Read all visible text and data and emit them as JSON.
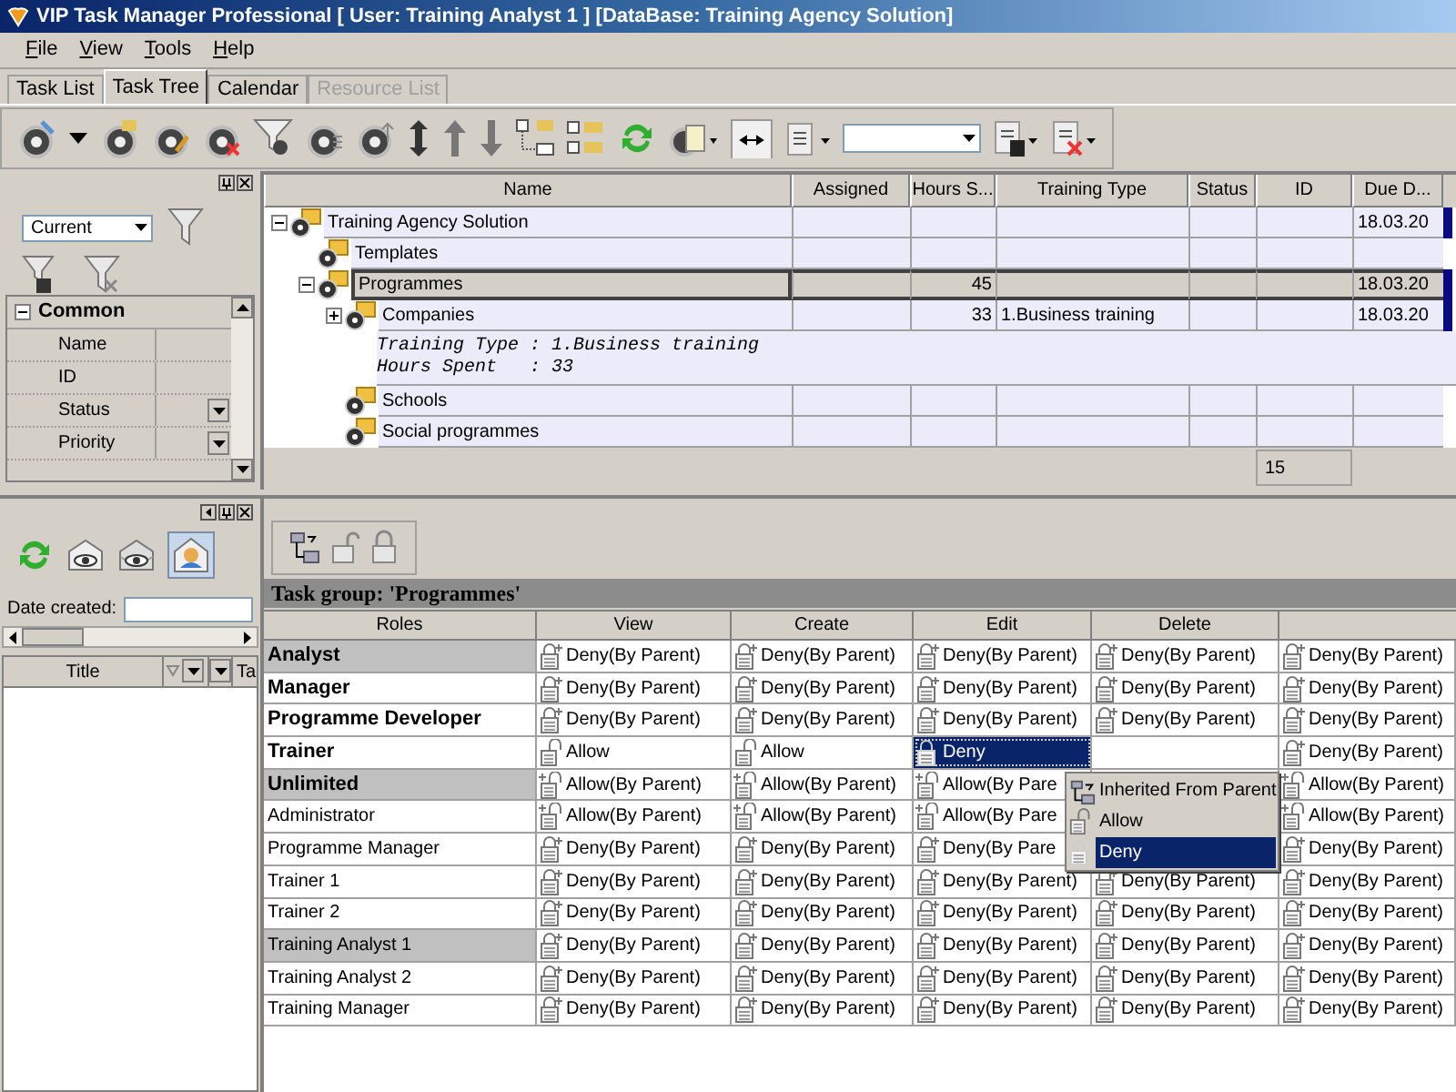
{
  "window": {
    "title": "VIP Task Manager Professional [ User: Training Analyst 1 ] [DataBase: Training Agency Solution]"
  },
  "menu": [
    "File",
    "View",
    "Tools",
    "Help"
  ],
  "tabs": [
    {
      "label": "Task List",
      "selected": false,
      "disabled": false
    },
    {
      "label": "Task Tree",
      "selected": true,
      "disabled": false
    },
    {
      "label": "Calendar",
      "selected": false,
      "disabled": false
    },
    {
      "label": "Resource List",
      "selected": false,
      "disabled": true
    }
  ],
  "filter_panel": {
    "view_select": "Current",
    "category": {
      "label": "Common",
      "expanded": true,
      "properties": [
        {
          "label": "Name",
          "kind": "text"
        },
        {
          "label": "ID",
          "kind": "text"
        },
        {
          "label": "Status",
          "kind": "dropdown"
        },
        {
          "label": "Priority",
          "kind": "dropdown"
        }
      ]
    }
  },
  "task_tree": {
    "columns": [
      "Name",
      "Assigned",
      "Hours S...",
      "Training Type",
      "Status",
      "ID",
      "Due D..."
    ],
    "nodes": [
      {
        "name": "Training Agency Solution",
        "expanded": true,
        "selected": false,
        "due": "18.03.20",
        "children": [
          {
            "name": "Templates",
            "selected": false
          },
          {
            "name": "Programmes",
            "expanded": true,
            "selected": true,
            "hours": "45",
            "due": "18.03.20",
            "children": [
              {
                "name": "Companies",
                "expanded": false,
                "selected": false,
                "hours": "33",
                "training_type": "1.Business training",
                "due": "18.03.20",
                "preview": [
                  "Training Type : 1.Business training",
                  "Hours Spent   : 33"
                ]
              },
              {
                "name": "Schools",
                "selected": false
              },
              {
                "name": "Social programmes",
                "selected": false
              }
            ]
          }
        ]
      }
    ],
    "footer_id": "15"
  },
  "search_panel": {
    "date_label": "Date created:",
    "columns": [
      "Title",
      "Ta"
    ]
  },
  "permissions": {
    "title": "Task group: 'Programmes'",
    "role_header": "Roles",
    "columns": [
      "View",
      "Create",
      "Edit",
      "Delete"
    ],
    "rows": [
      {
        "role": "Analyst",
        "kind": "group",
        "highlighted": true,
        "cells": [
          {
            "kind": "deny_inherited",
            "text": "Deny(By Parent)",
            "selected": false
          },
          {
            "kind": "deny_inherited",
            "text": "Deny(By Parent)",
            "selected": false
          },
          {
            "kind": "deny_inherited",
            "text": "Deny(By Parent)",
            "selected": false
          },
          {
            "kind": "deny_inherited",
            "text": "Deny(By Parent)",
            "selected": false
          },
          {
            "kind": "deny_inherited",
            "text": "Deny(By Parent)",
            "selected": false
          }
        ]
      },
      {
        "role": "Manager",
        "kind": "group",
        "highlighted": false,
        "cells": [
          {
            "kind": "deny_inherited",
            "text": "Deny(By Parent)",
            "selected": false
          },
          {
            "kind": "deny_inherited",
            "text": "Deny(By Parent)",
            "selected": false
          },
          {
            "kind": "deny_inherited",
            "text": "Deny(By Parent)",
            "selected": false
          },
          {
            "kind": "deny_inherited",
            "text": "Deny(By Parent)",
            "selected": false
          },
          {
            "kind": "deny_inherited",
            "text": "Deny(By Parent)",
            "selected": false
          }
        ]
      },
      {
        "role": "Programme Developer",
        "kind": "group",
        "highlighted": false,
        "cells": [
          {
            "kind": "deny_inherited",
            "text": "Deny(By Parent)",
            "selected": false
          },
          {
            "kind": "deny_inherited",
            "text": "Deny(By Parent)",
            "selected": false
          },
          {
            "kind": "deny_inherited",
            "text": "Deny(By Parent)",
            "selected": false
          },
          {
            "kind": "deny_inherited",
            "text": "Deny(By Parent)",
            "selected": false
          },
          {
            "kind": "deny_inherited",
            "text": "Deny(By Parent)",
            "selected": false
          }
        ]
      },
      {
        "role": "Trainer",
        "kind": "group",
        "highlighted": false,
        "cells": [
          {
            "kind": "allow",
            "text": "Allow",
            "selected": false
          },
          {
            "kind": "allow",
            "text": "Allow",
            "selected": false
          },
          {
            "kind": "deny",
            "text": "Deny",
            "selected": true
          },
          null,
          {
            "kind": "deny_inherited",
            "text": "Deny(By Parent)",
            "selected": false
          }
        ]
      },
      {
        "role": "Unlimited",
        "kind": "group",
        "highlighted": true,
        "cells": [
          {
            "kind": "allow_inherited",
            "text": "Allow(By Parent)",
            "selected": false
          },
          {
            "kind": "allow_inherited",
            "text": "Allow(By Parent)",
            "selected": false
          },
          {
            "kind": "allow_inherited",
            "text": "Allow(By Pare",
            "selected": false
          },
          null,
          {
            "kind": "allow_inherited",
            "text": "Allow(By Parent)",
            "selected": false
          }
        ]
      },
      {
        "role": "Administrator",
        "kind": "user",
        "highlighted": false,
        "cells": [
          {
            "kind": "allow_inherited",
            "text": "Allow(By Parent)",
            "selected": false
          },
          {
            "kind": "allow_inherited",
            "text": "Allow(By Parent)",
            "selected": false
          },
          {
            "kind": "allow_inherited",
            "text": "Allow(By Pare",
            "selected": false
          },
          null,
          {
            "kind": "allow_inherited",
            "text": "Allow(By Parent)",
            "selected": false
          }
        ]
      },
      {
        "role": "Programme Manager",
        "kind": "user",
        "highlighted": false,
        "cells": [
          {
            "kind": "deny_inherited",
            "text": "Deny(By Parent)",
            "selected": false
          },
          {
            "kind": "deny_inherited",
            "text": "Deny(By Parent)",
            "selected": false
          },
          {
            "kind": "deny_inherited",
            "text": "Deny(By Pare",
            "selected": false
          },
          null,
          {
            "kind": "deny_inherited",
            "text": "Deny(By Parent)",
            "selected": false
          }
        ]
      },
      {
        "role": "Trainer 1",
        "kind": "user",
        "highlighted": false,
        "cells": [
          {
            "kind": "deny_inherited",
            "text": "Deny(By Parent)",
            "selected": false
          },
          {
            "kind": "deny_inherited",
            "text": "Deny(By Parent)",
            "selected": false
          },
          {
            "kind": "deny_inherited",
            "text": "Deny(By Parent)",
            "selected": false
          },
          {
            "kind": "deny_inherited",
            "text": "Deny(By Parent)",
            "selected": false
          },
          {
            "kind": "deny_inherited",
            "text": "Deny(By Parent)",
            "selected": false
          }
        ]
      },
      {
        "role": "Trainer 2",
        "kind": "user",
        "highlighted": false,
        "cells": [
          {
            "kind": "deny_inherited",
            "text": "Deny(By Parent)",
            "selected": false
          },
          {
            "kind": "deny_inherited",
            "text": "Deny(By Parent)",
            "selected": false
          },
          {
            "kind": "deny_inherited",
            "text": "Deny(By Parent)",
            "selected": false
          },
          {
            "kind": "deny_inherited",
            "text": "Deny(By Parent)",
            "selected": false
          },
          {
            "kind": "deny_inherited",
            "text": "Deny(By Parent)",
            "selected": false
          }
        ]
      },
      {
        "role": "Training Analyst 1",
        "kind": "user",
        "highlighted": true,
        "cells": [
          {
            "kind": "deny_inherited",
            "text": "Deny(By Parent)",
            "selected": false
          },
          {
            "kind": "deny_inherited",
            "text": "Deny(By Parent)",
            "selected": false
          },
          {
            "kind": "deny_inherited",
            "text": "Deny(By Parent)",
            "selected": false
          },
          {
            "kind": "deny_inherited",
            "text": "Deny(By Parent)",
            "selected": false
          },
          {
            "kind": "deny_inherited",
            "text": "Deny(By Parent)",
            "selected": false
          }
        ]
      },
      {
        "role": "Training Analyst 2",
        "kind": "user",
        "highlighted": false,
        "cells": [
          {
            "kind": "deny_inherited",
            "text": "Deny(By Parent)",
            "selected": false
          },
          {
            "kind": "deny_inherited",
            "text": "Deny(By Parent)",
            "selected": false
          },
          {
            "kind": "deny_inherited",
            "text": "Deny(By Parent)",
            "selected": false
          },
          {
            "kind": "deny_inherited",
            "text": "Deny(By Parent)",
            "selected": false
          },
          {
            "kind": "deny_inherited",
            "text": "Deny(By Parent)",
            "selected": false
          }
        ]
      },
      {
        "role": "Training Manager",
        "kind": "user",
        "highlighted": false,
        "cells": [
          {
            "kind": "deny_inherited",
            "text": "Deny(By Parent)",
            "selected": false
          },
          {
            "kind": "deny_inherited",
            "text": "Deny(By Parent)",
            "selected": false
          },
          {
            "kind": "deny_inherited",
            "text": "Deny(By Parent)",
            "selected": false
          },
          {
            "kind": "deny_inherited",
            "text": "Deny(By Parent)",
            "selected": false
          },
          {
            "kind": "deny_inherited",
            "text": "Deny(By Parent)",
            "selected": false
          }
        ]
      }
    ],
    "context_menu": [
      {
        "label": "Inherited From Parent",
        "kind": "inherit",
        "selected": false
      },
      {
        "label": "Allow",
        "kind": "allow",
        "selected": false
      },
      {
        "label": "Deny",
        "kind": "deny",
        "selected": true
      }
    ]
  }
}
